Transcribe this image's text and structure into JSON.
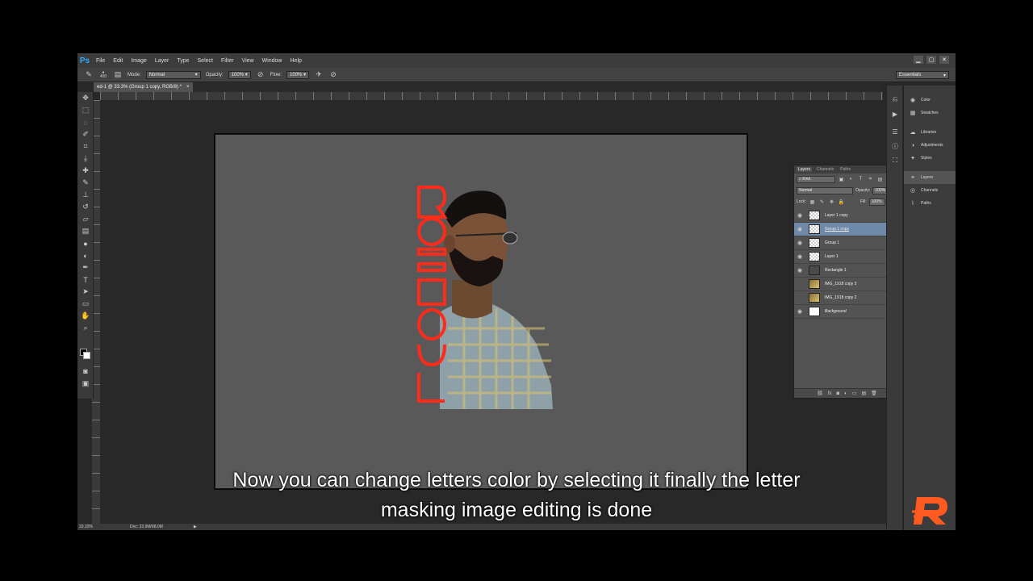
{
  "app": {
    "logo": "Ps",
    "menu": [
      "File",
      "Edit",
      "Image",
      "Layer",
      "Type",
      "Select",
      "Filter",
      "View",
      "Window",
      "Help"
    ],
    "window_controls": [
      "▁",
      "▢",
      "✕"
    ]
  },
  "options_bar": {
    "mode_label": "Mode:",
    "mode_value": "Normal",
    "opacity_label": "Opacity:",
    "opacity_value": "100%",
    "flow_label": "Flow:",
    "flow_value": "100%",
    "brush_size": "400",
    "workspace": "Essentials"
  },
  "document": {
    "tab_title": "ed-1 @ 33.3% (Group 1 copy, RGB/8) *",
    "close": "×"
  },
  "status_bar": {
    "zoom": "33.33%",
    "doc_info": "Doc: 23.9M/98.0M",
    "arrow": "▶"
  },
  "layers_panel": {
    "tabs": [
      "Layers",
      "Channels",
      "Paths"
    ],
    "filter_kind": "Kind",
    "blend_mode": "Normal",
    "opacity_label": "Opacity:",
    "opacity_value": "100%",
    "lock_label": "Lock:",
    "fill_label": "Fill:",
    "fill_value": "100%",
    "layers": [
      {
        "name": "Layer 1 copy",
        "visible": true,
        "thumb": "transparent",
        "selected": false,
        "locked": false,
        "clipped": true,
        "style": ""
      },
      {
        "name": "Group 1 copy",
        "visible": true,
        "thumb": "transparent",
        "selected": true,
        "locked": false,
        "clipped": false,
        "style": "underline"
      },
      {
        "name": "Group 1",
        "visible": true,
        "thumb": "transparent",
        "selected": false,
        "locked": false,
        "clipped": false,
        "style": ""
      },
      {
        "name": "Layer 1",
        "visible": true,
        "thumb": "transparent",
        "selected": false,
        "locked": false,
        "clipped": false,
        "style": ""
      },
      {
        "name": "Rectangle 1",
        "visible": true,
        "thumb": "dark",
        "selected": false,
        "locked": true,
        "clipped": false,
        "style": ""
      },
      {
        "name": "IMG_1918 copy 3",
        "visible": false,
        "thumb": "photo",
        "selected": false,
        "locked": false,
        "clipped": false,
        "style": ""
      },
      {
        "name": "IMG_1918 copy 2",
        "visible": false,
        "thumb": "photo",
        "selected": false,
        "locked": false,
        "clipped": false,
        "style": ""
      },
      {
        "name": "Background",
        "visible": true,
        "thumb": "white",
        "selected": false,
        "locked": true,
        "clipped": false,
        "style": "italic"
      }
    ],
    "footer_icons": [
      "⛓",
      "fx",
      "◙",
      "◐",
      "▭",
      "▤",
      "🗑"
    ]
  },
  "right_dock": {
    "group1": [
      {
        "label": "Color",
        "icon": "◉"
      },
      {
        "label": "Swatches",
        "icon": "▦"
      }
    ],
    "group2": [
      {
        "label": "Libraries",
        "icon": "☁"
      },
      {
        "label": "Adjustments",
        "icon": "◑"
      },
      {
        "label": "Styles",
        "icon": "✦"
      }
    ],
    "group3": [
      {
        "label": "Layers",
        "icon": "≡"
      },
      {
        "label": "Channels",
        "icon": "◎"
      },
      {
        "label": "Paths",
        "icon": "⌇"
      }
    ]
  },
  "subtitle": {
    "line1": "Now you can change letters color by selecting it  finally the letter",
    "line2": "masking image editing is done"
  },
  "colors": {
    "ps_blue": "#31a8ff",
    "selection": "#6f8aa8",
    "text_outline_red": "#ff2a1a",
    "brand_orange": "#ff5a1f"
  }
}
